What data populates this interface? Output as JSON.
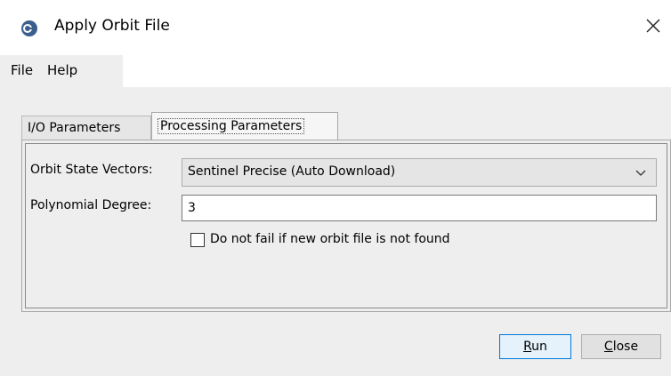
{
  "window": {
    "title": "Apply Orbit File",
    "icon": "esa-snap-app-icon",
    "close_icon": "close-x-icon"
  },
  "menu": {
    "items": [
      {
        "label": "File"
      },
      {
        "label": "Help"
      }
    ]
  },
  "tabs": [
    {
      "label": "I/O Parameters",
      "selected": false
    },
    {
      "label": "Processing Parameters",
      "selected": true
    }
  ],
  "form": {
    "orbit_state_vectors": {
      "label": "Orbit State Vectors:",
      "value": "Sentinel Precise (Auto Download)",
      "arrow_icon": "chevron-down-icon"
    },
    "polynomial_degree": {
      "label": "Polynomial Degree:",
      "value": "3"
    },
    "do_not_fail": {
      "label": "Do not fail if new orbit file is not found",
      "checked": false
    }
  },
  "buttons": {
    "run": {
      "mnemonic": "R",
      "rest": "un"
    },
    "close": {
      "mnemonic": "C",
      "rest": "lose"
    }
  }
}
